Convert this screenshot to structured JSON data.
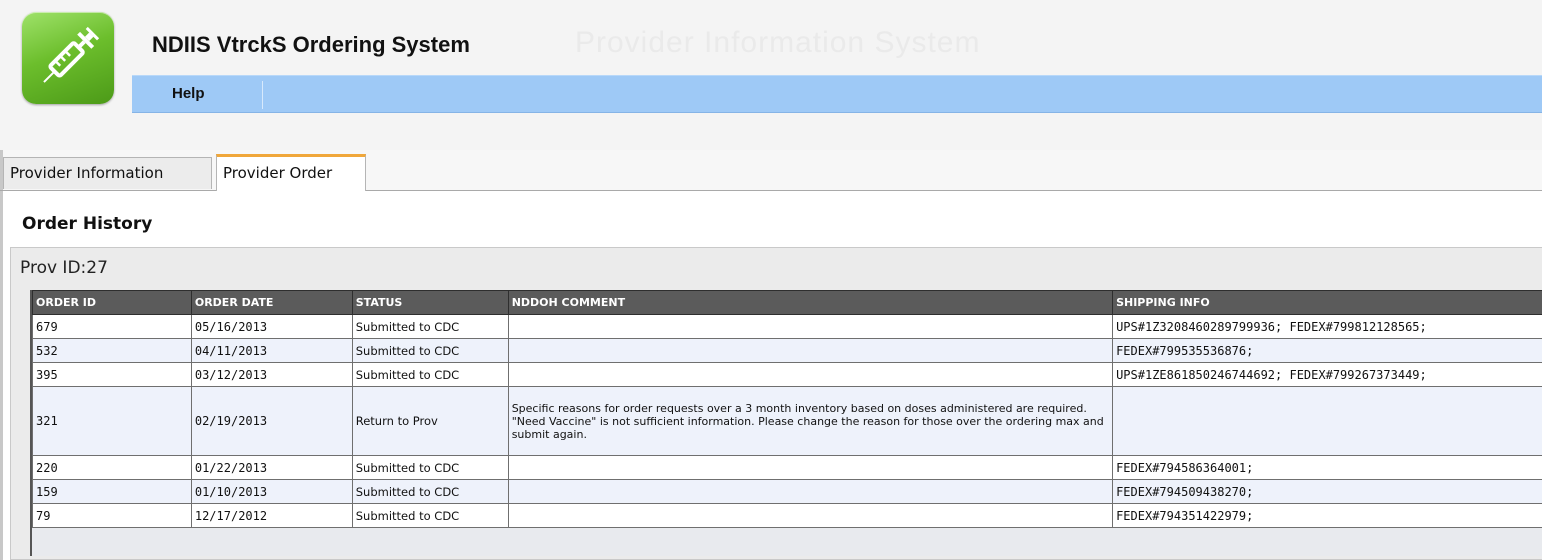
{
  "app": {
    "title": "NDIIS VtrckS Ordering System",
    "ghost_title": "Provider Information System"
  },
  "menu": {
    "help_label": "Help"
  },
  "tabs": [
    {
      "label": "Provider Information",
      "active": false
    },
    {
      "label": "Provider Order",
      "active": true
    }
  ],
  "section": {
    "title": "Order History",
    "prov_id": "Prov ID:27"
  },
  "table": {
    "columns": [
      "ORDER ID",
      "ORDER DATE",
      "STATUS",
      "NDDOH COMMENT",
      "SHIPPING INFO"
    ],
    "rows": [
      {
        "order_id": "679",
        "order_date": "05/16/2013",
        "status": "Submitted to CDC",
        "comment": "",
        "shipping": "UPS#1Z3208460289799936; FEDEX#799812128565;"
      },
      {
        "order_id": "532",
        "order_date": "04/11/2013",
        "status": "Submitted to CDC",
        "comment": "",
        "shipping": "FEDEX#799535536876;"
      },
      {
        "order_id": "395",
        "order_date": "03/12/2013",
        "status": "Submitted to CDC",
        "comment": "",
        "shipping": "UPS#1ZE861850246744692; FEDEX#799267373449;"
      },
      {
        "order_id": "321",
        "order_date": "02/19/2013",
        "status": "Return to Prov",
        "comment": "Specific reasons for order requests over a 3 month inventory based on doses administered are required. \"Need Vaccine\" is not sufficient information. Please change the reason for those over the ordering max and submit again.",
        "shipping": ""
      },
      {
        "order_id": "220",
        "order_date": "01/22/2013",
        "status": "Submitted to CDC",
        "comment": "",
        "shipping": "FEDEX#794586364001;"
      },
      {
        "order_id": "159",
        "order_date": "01/10/2013",
        "status": "Submitted to CDC",
        "comment": "",
        "shipping": "FEDEX#794509438270;"
      },
      {
        "order_id": "79",
        "order_date": "12/17/2012",
        "status": "Submitted to CDC",
        "comment": "",
        "shipping": "FEDEX#794351422979;"
      }
    ]
  },
  "colors": {
    "menubar": "#9ec9f6",
    "tab_accent": "#f0a73b",
    "header_row": "#5b5b5b",
    "logo_green": "#6cbe2c"
  },
  "icons": {
    "logo": "syringe-icon"
  }
}
